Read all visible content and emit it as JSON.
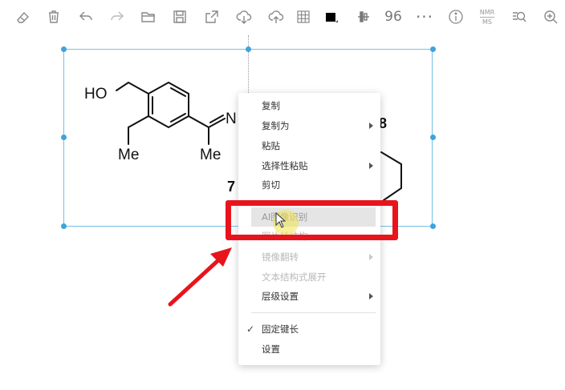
{
  "toolbar": {
    "zoom_value": "96",
    "nmr_line1": "NMR",
    "nmr_line2": "MS",
    "icons": [
      "eraser-icon",
      "trash-icon",
      "undo-icon",
      "redo-icon",
      "folder-open-icon",
      "save-icon",
      "export-icon",
      "cloud-download-icon",
      "cloud-upload-icon",
      "grid-icon",
      "color-swatch-icon",
      "align-icon",
      "more-icon",
      "info-icon",
      "nmr-ms-icon",
      "zoom-fit-icon",
      "zoom-in-icon"
    ]
  },
  "molecule": {
    "label_ho": "HO",
    "label_me1": "Me",
    "label_n": "N",
    "label_me2": "Me",
    "label_7": "7",
    "label_partial": "8"
  },
  "context_menu": {
    "items": [
      {
        "label": "复制",
        "disabled": false,
        "submenu": false
      },
      {
        "label": "复制为",
        "disabled": false,
        "submenu": true
      },
      {
        "label": "粘贴",
        "disabled": false,
        "submenu": false
      },
      {
        "label": "选择性粘贴",
        "disabled": false,
        "submenu": true
      },
      {
        "label": "剪切",
        "disabled": false,
        "submenu": false
      },
      {
        "label": "AI图像识别",
        "disabled": true,
        "submenu": false,
        "highlighted": true
      },
      {
        "label": "图片转结构",
        "disabled": true,
        "submenu": false
      },
      {
        "label": "镜像翻转",
        "disabled": true,
        "submenu": true
      },
      {
        "label": "文本结构式展开",
        "disabled": true,
        "submenu": false
      },
      {
        "label": "层级设置",
        "disabled": false,
        "submenu": true
      },
      {
        "label": "固定键长",
        "disabled": false,
        "submenu": false,
        "checked": true
      },
      {
        "label": "设置",
        "disabled": false,
        "submenu": false
      }
    ]
  },
  "colors": {
    "selection_border": "#74c0e6",
    "handle": "#3ea4dc",
    "annotation_red": "#e8141c"
  }
}
